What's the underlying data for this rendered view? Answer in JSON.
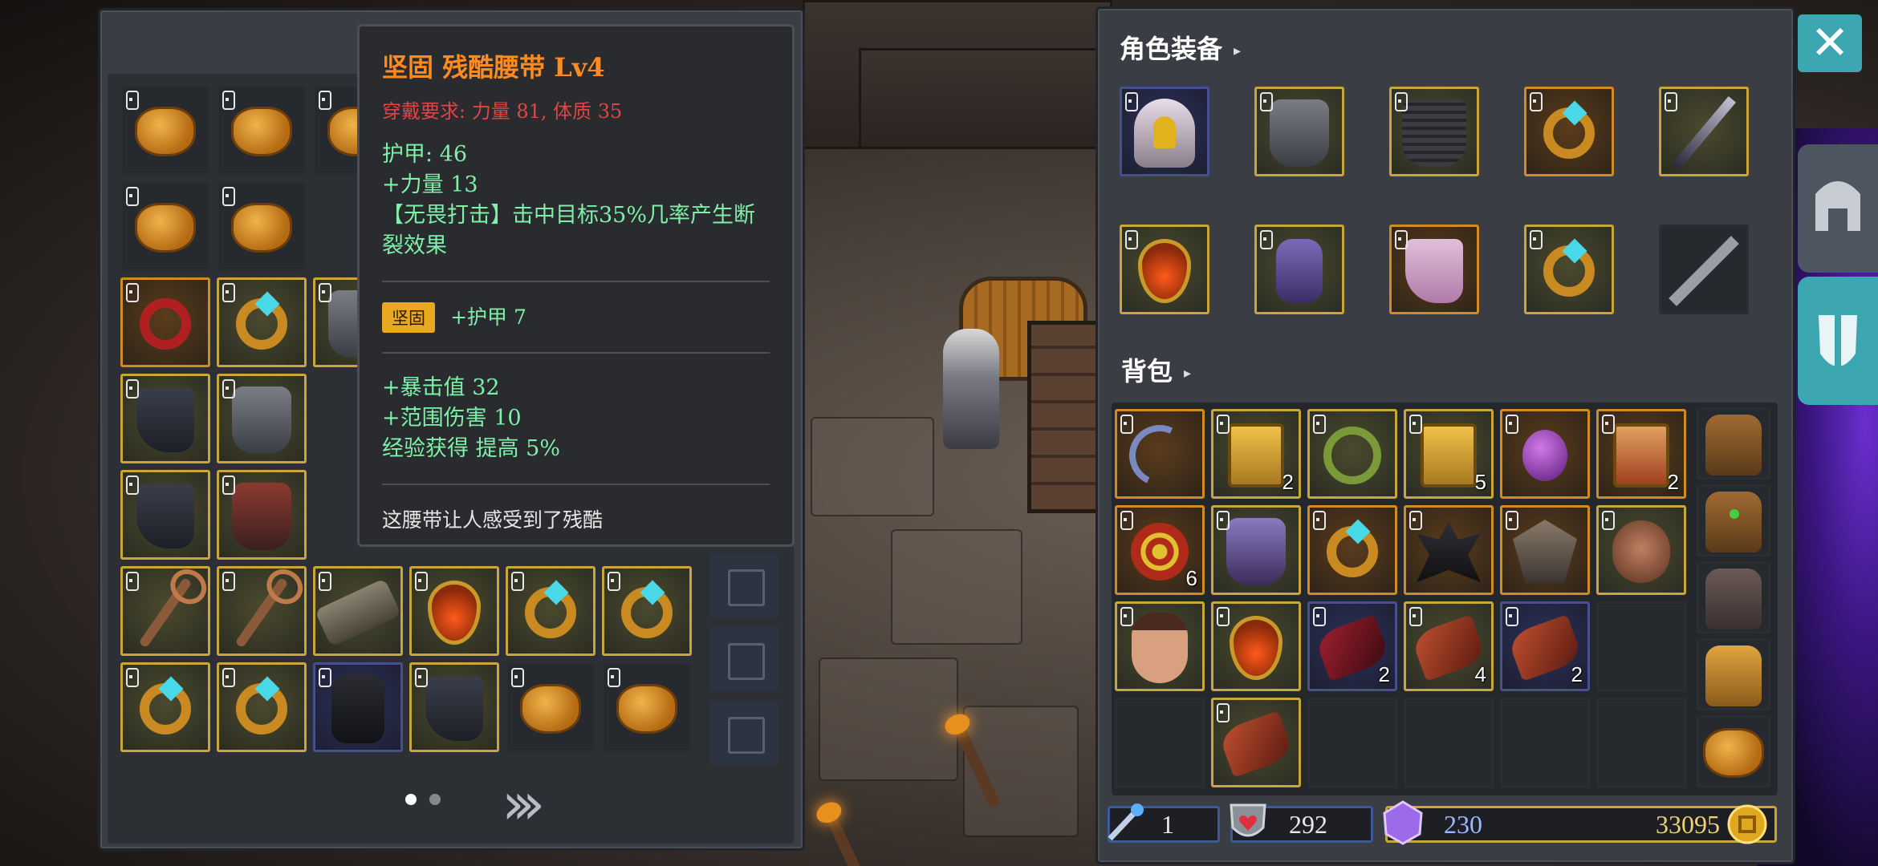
{
  "tooltip": {
    "title": "坚固 残酷腰带 Lv4",
    "requirement": "穿戴要求:  力量 81, 体质 35",
    "base_stats": [
      "护甲:  46",
      "+力量 13",
      "【无畏打击】击中目标35%几率产生断裂效果"
    ],
    "affix_badge": "坚固",
    "affix_text": "+护甲 7",
    "bonus_stats": [
      "+暴击值 32",
      "+范围伤害 10",
      "经验获得 提高 5%"
    ],
    "description": "这腰带让人感受到了残酷"
  },
  "equipment": {
    "title": "角色装备",
    "slots": [
      {
        "item": "helmet",
        "rarity": "blue"
      },
      {
        "item": "chest-armor",
        "rarity": "gold"
      },
      {
        "item": "chainmail",
        "rarity": "gold"
      },
      {
        "item": "ring",
        "rarity": "orange"
      },
      {
        "item": "dagger",
        "rarity": "gold"
      },
      {
        "item": "amulet",
        "rarity": "gold"
      },
      {
        "item": "gloves",
        "rarity": "gold"
      },
      {
        "item": "leggings",
        "rarity": "orange"
      },
      {
        "item": "ring",
        "rarity": "gold"
      },
      {
        "item": "empty-weapon-slot",
        "rarity": "dark"
      }
    ]
  },
  "backpack": {
    "title": "背包",
    "items": [
      {
        "item": "bow",
        "rarity": "orange",
        "count": ""
      },
      {
        "item": "scroll",
        "rarity": "gold",
        "count": "2"
      },
      {
        "item": "wreath",
        "rarity": "gold",
        "count": ""
      },
      {
        "item": "blue-scroll",
        "rarity": "gold",
        "count": "5"
      },
      {
        "item": "potion",
        "rarity": "orange",
        "count": ""
      },
      {
        "item": "red-scroll",
        "rarity": "orange",
        "count": "2"
      },
      {
        "item": "swirl-orb",
        "rarity": "orange",
        "count": "6"
      },
      {
        "item": "purple-armor",
        "rarity": "gold",
        "count": ""
      },
      {
        "item": "blue-ring",
        "rarity": "orange",
        "count": ""
      },
      {
        "item": "spiky-helm",
        "rarity": "orange",
        "count": ""
      },
      {
        "item": "horned-mask",
        "rarity": "orange",
        "count": ""
      },
      {
        "item": "gas-mask",
        "rarity": "gold",
        "count": ""
      },
      {
        "item": "portrait",
        "rarity": "gold",
        "count": ""
      },
      {
        "item": "amulet",
        "rarity": "gold",
        "count": ""
      },
      {
        "item": "red-claw",
        "rarity": "blue",
        "count": "2"
      },
      {
        "item": "claw",
        "rarity": "gold",
        "count": "4"
      },
      {
        "item": "talon",
        "rarity": "blue",
        "count": "2"
      },
      {
        "item": "empty",
        "rarity": "dark",
        "count": ""
      },
      {
        "item": "empty",
        "rarity": "dark",
        "count": ""
      },
      {
        "item": "claw",
        "rarity": "gold",
        "count": ""
      },
      {
        "item": "empty",
        "rarity": "dark",
        "count": ""
      },
      {
        "item": "empty",
        "rarity": "dark",
        "count": ""
      },
      {
        "item": "empty",
        "rarity": "dark",
        "count": ""
      },
      {
        "item": "empty",
        "rarity": "dark",
        "count": ""
      }
    ],
    "bag_tabs": [
      "bag-orange",
      "bag-green",
      "bag-gray",
      "bag-gold",
      "bag-pouch"
    ]
  },
  "stash": {
    "rows": [
      [
        "bag",
        "bag",
        "bag",
        "",
        "",
        ""
      ],
      [
        "bag",
        "bag",
        "",
        "",
        "",
        ""
      ],
      [
        "red-ring",
        "ring",
        "dark-armor",
        "",
        "",
        ""
      ],
      [
        "boots",
        "plate-armor",
        "",
        "",
        "",
        ""
      ],
      [
        "boots",
        "red-armor",
        "",
        "",
        "",
        ""
      ],
      [
        "staff",
        "staff",
        "belt",
        "amulet",
        "ring",
        "ring"
      ],
      [
        "ring",
        "ring",
        "gauntlet",
        "boots",
        "bag",
        "bag"
      ]
    ],
    "rarity": [
      [
        "dark",
        "dark",
        "dark",
        "",
        "",
        ""
      ],
      [
        "dark",
        "dark",
        "dark",
        "",
        "",
        ""
      ],
      [
        "orange",
        "gold",
        "gold",
        "",
        "",
        ""
      ],
      [
        "gold",
        "gold",
        "gold",
        "",
        "",
        ""
      ],
      [
        "gold",
        "gold",
        "gold",
        "",
        "",
        ""
      ],
      [
        "gold",
        "gold",
        "gold",
        "gold",
        "gold",
        "gold"
      ],
      [
        "gold",
        "gold",
        "blue",
        "gold",
        "dark",
        "dark"
      ]
    ]
  },
  "currency": {
    "wands": "1",
    "hearts": "292",
    "gems": "230",
    "gold": "33095"
  },
  "colors": {
    "accent": "#3ca7b0",
    "tooltip_title": "#ff8a1e",
    "stat_green": "#7ef0a8",
    "requirement_red": "#e04545"
  }
}
